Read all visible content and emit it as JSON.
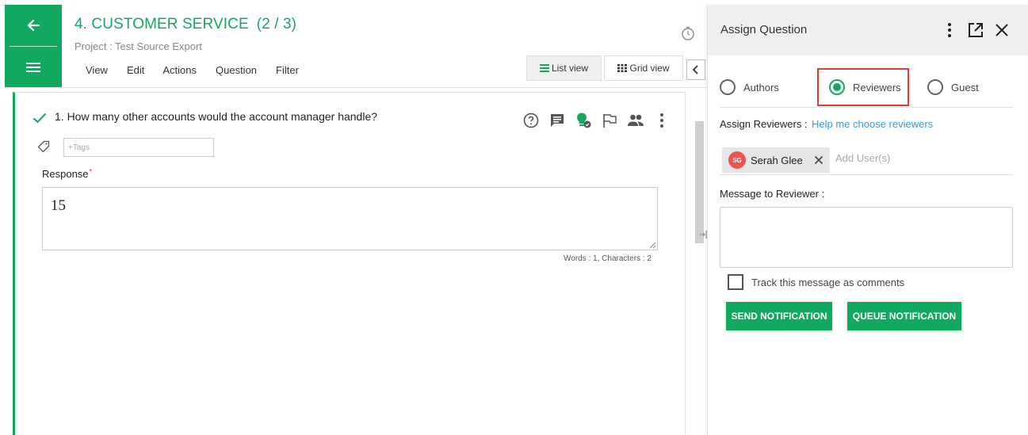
{
  "colors": {
    "brand_green": "#11a860",
    "link_blue": "#3a9ad9",
    "highlight_red": "#e53935",
    "avatar_red": "#ef5350"
  },
  "nav": {
    "back_icon": "arrow-left-icon",
    "menu_icon": "hamburger-menu-icon"
  },
  "header": {
    "title": "4. CUSTOMER SERVICE",
    "progress": "(2 / 3)",
    "project": "Project : Test Source Export",
    "menu": [
      "View",
      "Edit",
      "Actions",
      "Question",
      "Filter"
    ],
    "list_view_label": "List view",
    "grid_view_label": "Grid view"
  },
  "question": {
    "text": "1. How many other accounts would the account manager handle?",
    "tags_placeholder": "+Tags",
    "response_label": "Response",
    "required_mark": "*",
    "response_value": "15",
    "word_count": "Words : 1, Characters : 2",
    "icons": [
      "help-icon",
      "comment-icon",
      "lightbulb-icon",
      "flag-icon",
      "people-icon",
      "more-vertical-icon"
    ]
  },
  "panel": {
    "title": "Assign Question",
    "radio_options": [
      {
        "label": "Authors",
        "selected": false
      },
      {
        "label": "Reviewers",
        "selected": true
      },
      {
        "label": "Guest",
        "selected": false
      }
    ],
    "assign_label": "Assign Reviewers :",
    "help_link": "Help me choose reviewers",
    "chip": {
      "initials": "SG",
      "name": "Serah Glee"
    },
    "add_user_placeholder": "Add User(s)",
    "message_label": "Message to Reviewer :",
    "track_label": "Track this message as comments",
    "track_checked": false,
    "send_label": "SEND NOTIFICATION",
    "queue_label": "QUEUE NOTIFICATION"
  }
}
